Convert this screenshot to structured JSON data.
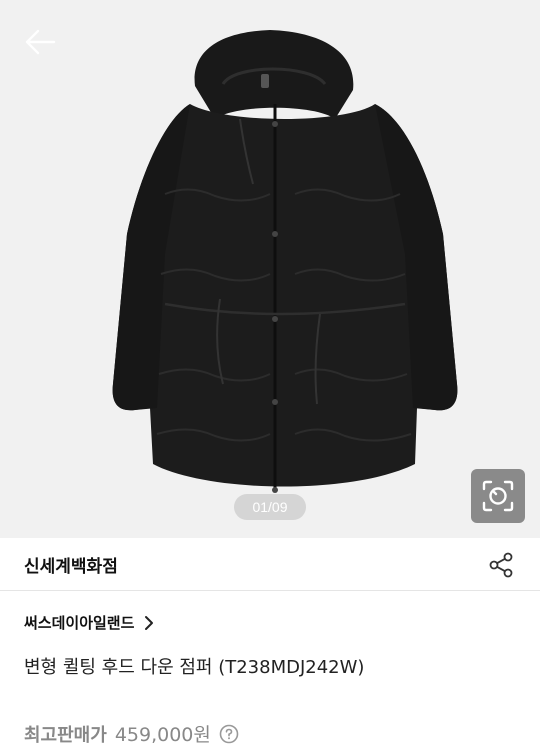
{
  "gallery": {
    "counter": "01/09"
  },
  "store": {
    "name": "신세계백화점"
  },
  "product": {
    "brand": "써스데이아일랜드",
    "name": "변형 퀼팅 후드 다운 점퍼 (T238MDJ242W)",
    "price_label": "최고판매가",
    "price": "459,000원"
  },
  "icons": {
    "back": "arrow-left-icon",
    "lens": "camera-search-icon",
    "share": "share-icon",
    "brand_chevron": "chevron-right-icon",
    "info": "question-circle-icon"
  },
  "colors": {
    "hero_bg": "#f1f1f1",
    "jacket": "#1b1b1b",
    "muted_text": "#888888"
  }
}
